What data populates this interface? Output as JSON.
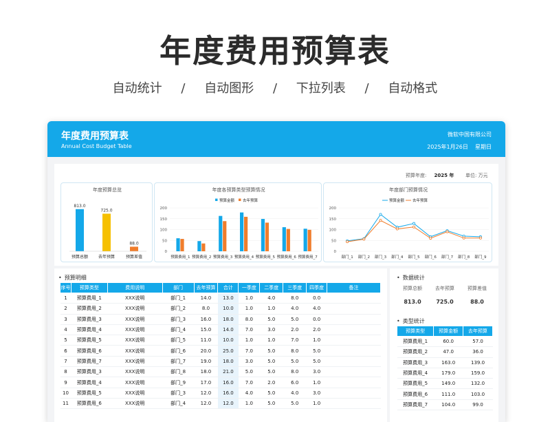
{
  "hero": {
    "title": "年度费用预算表",
    "features": [
      "自动统计",
      "/",
      "自动图形",
      "/",
      "下拉列表",
      "/",
      "自动格式"
    ]
  },
  "header": {
    "title": "年度费用预算表",
    "subtitle": "Annual Cost Budget Table",
    "company": "微软中国有限公司",
    "date": "2025年1月26日",
    "weekday": "星期日"
  },
  "meta": {
    "year_label": "预算年度:",
    "year_value": "2025 年",
    "unit_label": "单位: 万元"
  },
  "chart_data": [
    {
      "type": "bar",
      "title": "年度预算总览",
      "categories": [
        "预算总额",
        "去年预算",
        "预算差值"
      ],
      "values": [
        813.0,
        725.0,
        88.0
      ],
      "data_labels": [
        "813.0",
        "725.0",
        "88.0"
      ],
      "colors": [
        "#14a8e9",
        "#f6c000",
        "#f07d2c"
      ]
    },
    {
      "type": "bar",
      "title": "年度各预算类型预算情况",
      "legend": [
        "预算金额",
        "去年预算"
      ],
      "legend_position": "top",
      "categories": [
        "预算费用_1",
        "预算费用_2",
        "预算费用_3",
        "预算费用_4",
        "预算费用_5",
        "预算费用_6",
        "预算费用_7"
      ],
      "series": [
        {
          "name": "预算金额",
          "values": [
            60.0,
            47.0,
            163.0,
            179.0,
            149.0,
            111.0,
            104.0
          ],
          "color": "#14a8e9"
        },
        {
          "name": "去年预算",
          "values": [
            57.0,
            36.0,
            139.0,
            159.0,
            132.0,
            103.0,
            99.0
          ],
          "color": "#f07d2c"
        }
      ],
      "ylim": [
        0,
        200
      ],
      "yticks": [
        "0",
        "50",
        "100",
        "150",
        "200"
      ]
    },
    {
      "type": "line",
      "title": "年度部门预算情况",
      "legend": [
        "预算金额",
        "去年预算"
      ],
      "legend_position": "top",
      "categories": [
        "部门_1",
        "部门_2",
        "部门_3",
        "部门_4",
        "部门_5",
        "部门_6",
        "部门_7",
        "部门_8",
        "部门_9"
      ],
      "series": [
        {
          "name": "预算金额",
          "values": [
            48,
            58,
            170,
            111,
            128,
            67,
            95,
            70,
            67
          ],
          "color": "#14a8e9"
        },
        {
          "name": "去年预算",
          "values": [
            44,
            56,
            142,
            103,
            112,
            60,
            90,
            61,
            61
          ],
          "color": "#f07d2c"
        }
      ],
      "ylim": [
        0,
        200
      ],
      "yticks": [
        "0",
        "50",
        "100",
        "150",
        "200"
      ]
    }
  ],
  "detail": {
    "section_title": "预算明细",
    "columns": [
      "序号",
      "预算类型",
      "费用说明",
      "部门",
      "去年预算",
      "合计",
      "一季度",
      "二季度",
      "三季度",
      "四季度",
      "备注"
    ],
    "rows": [
      [
        "1",
        "预算费用_1",
        "XXX说明",
        "部门_1",
        "14.0",
        "13.0",
        "1.0",
        "4.0",
        "8.0",
        "0.0",
        ""
      ],
      [
        "2",
        "预算费用_2",
        "XXX说明",
        "部门_2",
        "8.0",
        "10.0",
        "1.0",
        "1.0",
        "4.0",
        "4.0",
        ""
      ],
      [
        "3",
        "预算费用_3",
        "XXX说明",
        "部门_3",
        "16.0",
        "18.0",
        "8.0",
        "5.0",
        "5.0",
        "0.0",
        ""
      ],
      [
        "4",
        "预算费用_4",
        "XXX说明",
        "部门_4",
        "15.0",
        "14.0",
        "7.0",
        "3.0",
        "2.0",
        "2.0",
        ""
      ],
      [
        "5",
        "预算费用_5",
        "XXX说明",
        "部门_5",
        "11.0",
        "10.0",
        "1.0",
        "1.0",
        "7.0",
        "1.0",
        ""
      ],
      [
        "6",
        "预算费用_6",
        "XXX说明",
        "部门_6",
        "20.0",
        "25.0",
        "7.0",
        "5.0",
        "8.0",
        "5.0",
        ""
      ],
      [
        "7",
        "预算费用_7",
        "XXX说明",
        "部门_7",
        "19.0",
        "18.0",
        "3.0",
        "5.0",
        "5.0",
        "5.0",
        ""
      ],
      [
        "8",
        "预算费用_3",
        "XXX说明",
        "部门_8",
        "18.0",
        "21.0",
        "5.0",
        "5.0",
        "8.0",
        "3.0",
        ""
      ],
      [
        "9",
        "预算费用_4",
        "XXX说明",
        "部门_9",
        "17.0",
        "16.0",
        "7.0",
        "2.0",
        "6.0",
        "1.0",
        ""
      ],
      [
        "10",
        "预算费用_5",
        "XXX说明",
        "部门_3",
        "12.0",
        "16.0",
        "4.0",
        "5.0",
        "4.0",
        "3.0",
        ""
      ],
      [
        "11",
        "预算费用_6",
        "XXX说明",
        "部门_4",
        "12.0",
        "12.0",
        "1.0",
        "5.0",
        "5.0",
        "1.0",
        ""
      ]
    ]
  },
  "stats": {
    "section_title": "数据统计",
    "labels": [
      "预算总额",
      "去年预算",
      "预算差值"
    ],
    "values": [
      "813.0",
      "725.0",
      "88.0"
    ]
  },
  "type_stats": {
    "section_title": "类型统计",
    "columns": [
      "预算类型",
      "预算金额",
      "去年预算"
    ],
    "rows": [
      [
        "预算费用_1",
        "60.0",
        "57.0"
      ],
      [
        "预算费用_2",
        "47.0",
        "36.0"
      ],
      [
        "预算费用_3",
        "163.0",
        "139.0"
      ],
      [
        "预算费用_4",
        "179.0",
        "159.0"
      ],
      [
        "预算费用_5",
        "149.0",
        "132.0"
      ],
      [
        "预算费用_6",
        "111.0",
        "103.0"
      ],
      [
        "预算费用_7",
        "104.0",
        "99.0"
      ]
    ]
  }
}
